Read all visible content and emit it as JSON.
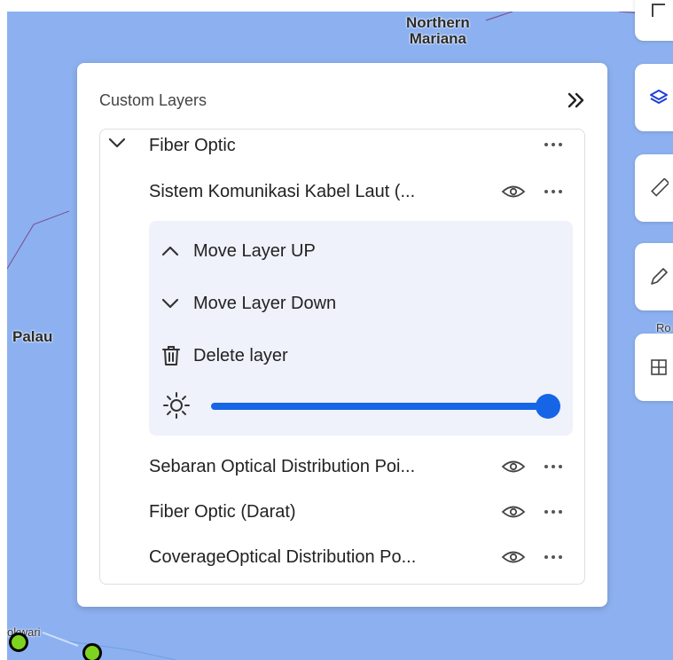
{
  "map": {
    "labels": {
      "northern_line1": "Northern",
      "northern_line2": "Mariana",
      "palau": "Palau",
      "manokwari": "okwari",
      "ro": "Ro"
    }
  },
  "toolbar": {
    "icons": [
      "location-icon",
      "layers-icon",
      "ruler-icon",
      "pencil-icon",
      "map-grid-icon"
    ]
  },
  "panel": {
    "title": "Custom Layers",
    "group": {
      "label": "Fiber Optic",
      "layers": [
        {
          "label": "Sistem Komunikasi Kabel Laut (..."
        },
        {
          "label": "Sebaran Optical Distribution Poi..."
        },
        {
          "label": "Fiber Optic (Darat)"
        },
        {
          "label": "CoverageOptical Distribution Po..."
        }
      ]
    },
    "context_menu": {
      "move_up": "Move Layer UP",
      "move_down": "Move Layer Down",
      "delete": "Delete layer",
      "opacity": 1.0
    }
  },
  "colors": {
    "map_water": "#8db1f0",
    "accent": "#1565e6",
    "menu_bg": "#eff1fb",
    "marker_fill": "#7ed321"
  }
}
